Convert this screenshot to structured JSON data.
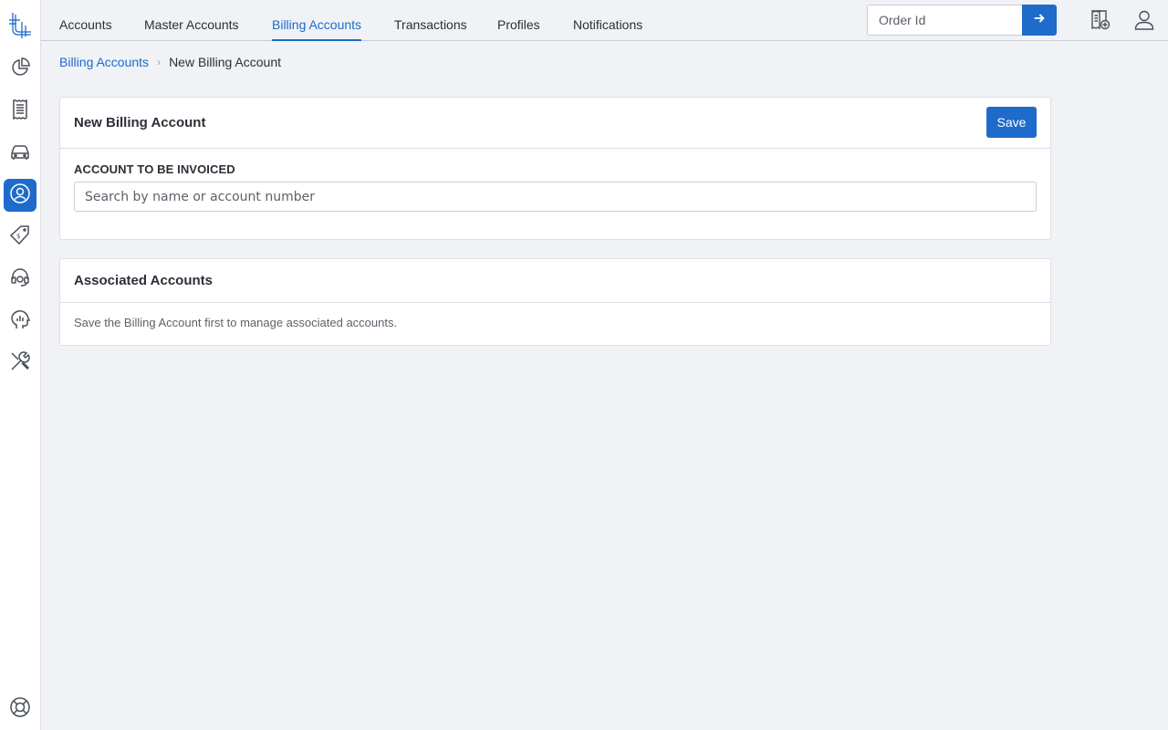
{
  "sidebar": {
    "items": [
      {
        "icon": "pie-chart-icon",
        "active": false
      },
      {
        "icon": "receipt-icon",
        "active": false
      },
      {
        "icon": "car-icon",
        "active": false
      },
      {
        "icon": "user-circle-icon",
        "active": true
      },
      {
        "icon": "price-tag-icon",
        "active": false
      },
      {
        "icon": "headset-icon",
        "active": false
      },
      {
        "icon": "analytics-head-icon",
        "active": false
      },
      {
        "icon": "tools-icon",
        "active": false
      }
    ],
    "bottom_icon": "lifebuoy-icon"
  },
  "nav": {
    "tabs": [
      {
        "label": "Accounts"
      },
      {
        "label": "Master Accounts"
      },
      {
        "label": "Billing Accounts"
      },
      {
        "label": "Transactions"
      },
      {
        "label": "Profiles"
      },
      {
        "label": "Notifications"
      }
    ],
    "active_tab": "Billing Accounts",
    "order_search_placeholder": "Order Id",
    "order_search_value": ""
  },
  "breadcrumb": {
    "parent": "Billing Accounts",
    "current": "New Billing Account"
  },
  "billing_card": {
    "title": "New Billing Account",
    "save_label": "Save",
    "field_label": "ACCOUNT TO BE INVOICED",
    "search_placeholder": "Search by name or account number",
    "search_value": ""
  },
  "associated_card": {
    "title": "Associated Accounts",
    "note": "Save the Billing Account first to manage associated accounts."
  },
  "colors": {
    "accent": "#1e6bcb",
    "background": "#f0f2f6",
    "text": "#2b2f36"
  }
}
